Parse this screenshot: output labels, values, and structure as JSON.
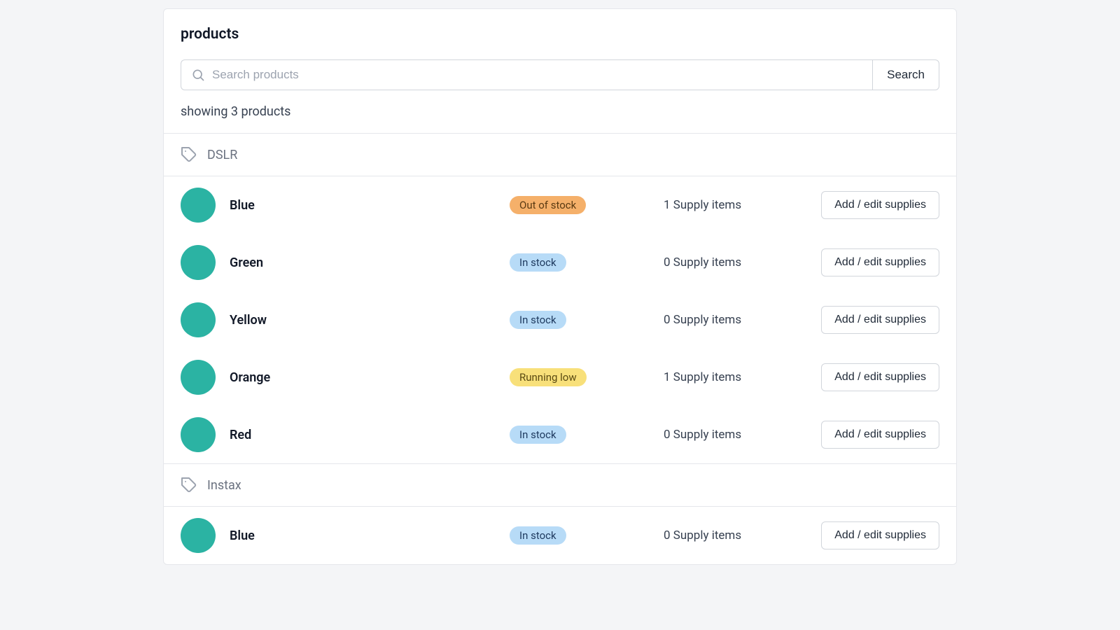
{
  "title": "products",
  "search": {
    "placeholder": "Search products",
    "button": "Search"
  },
  "showing": "showing 3 products",
  "action_label": "Add / edit supplies",
  "status_labels": {
    "out": "Out of stock",
    "in": "In stock",
    "low": "Running low"
  },
  "groups": [
    {
      "name": "DSLR",
      "variants": [
        {
          "name": "Blue",
          "status": "out",
          "supply": "1 Supply items"
        },
        {
          "name": "Green",
          "status": "in",
          "supply": "0 Supply items"
        },
        {
          "name": "Yellow",
          "status": "in",
          "supply": "0 Supply items"
        },
        {
          "name": "Orange",
          "status": "low",
          "supply": "1 Supply items"
        },
        {
          "name": "Red",
          "status": "in",
          "supply": "0 Supply items"
        }
      ]
    },
    {
      "name": "Instax",
      "variants": [
        {
          "name": "Blue",
          "status": "in",
          "supply": "0 Supply items"
        }
      ]
    }
  ]
}
